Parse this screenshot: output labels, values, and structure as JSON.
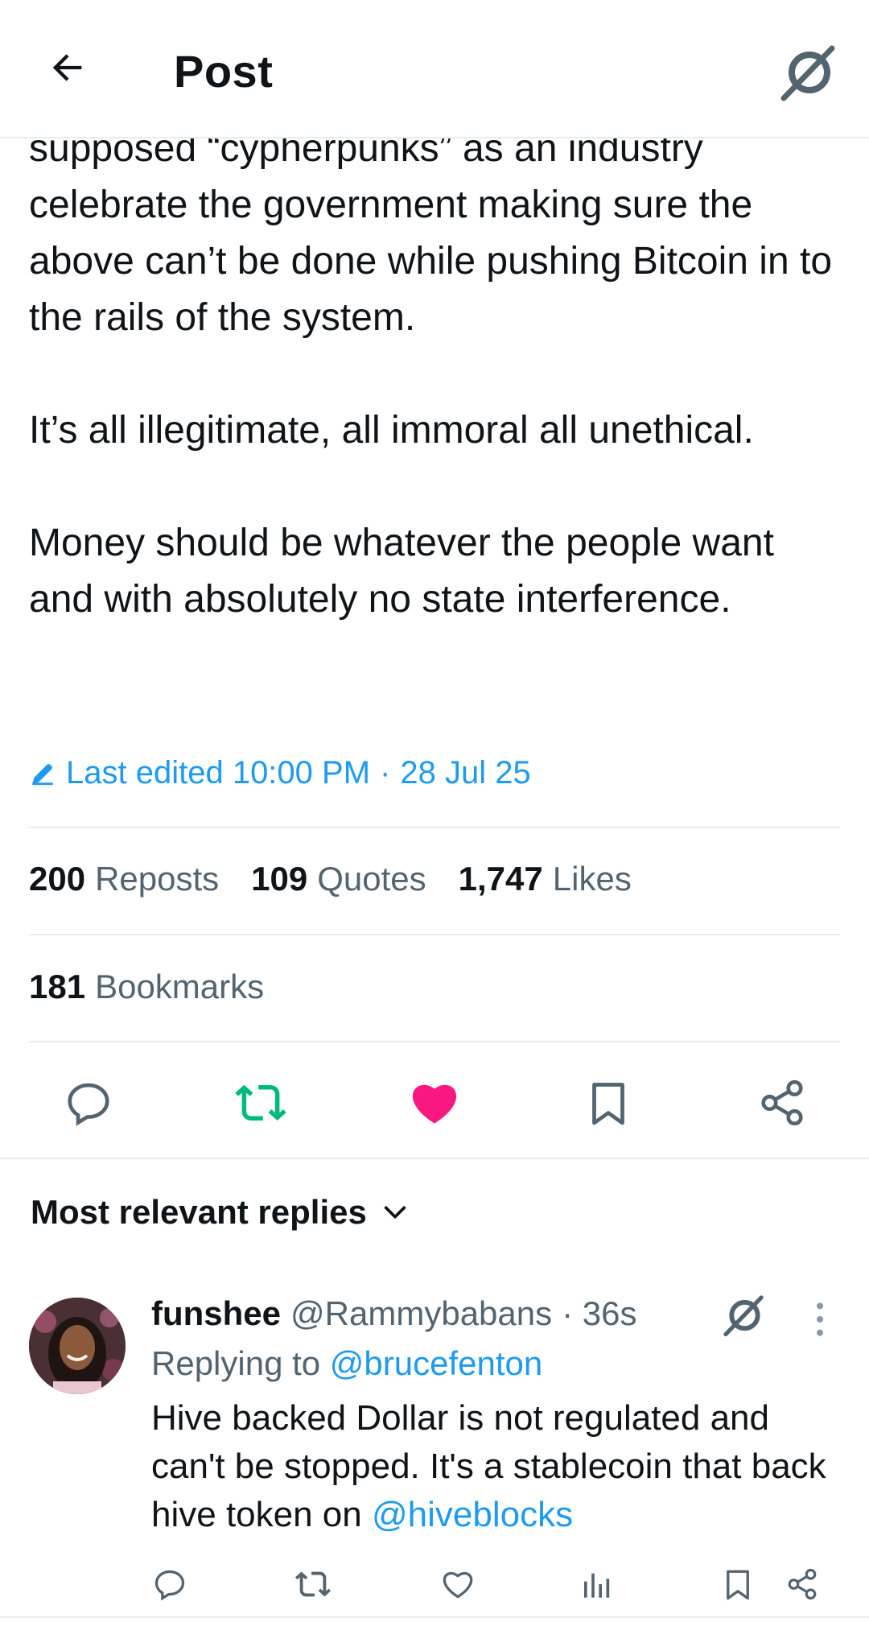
{
  "header": {
    "title": "Post"
  },
  "post": {
    "paragraphs": [
      "supposed “cypherpunks” as an industry celebrate the government making sure the above can’t be done while pushing Bitcoin in to the rails of the system.",
      "It’s all illegitimate, all immoral all unethical.",
      "Money should be whatever the people want and with absolutely no state interference."
    ],
    "edited_label": "Last edited 10:00 PM",
    "edited_date": "28 Jul 25",
    "stats": {
      "reposts_count": "200",
      "reposts_label": "Reposts",
      "quotes_count": "109",
      "quotes_label": "Quotes",
      "likes_count": "1,747",
      "likes_label": "Likes",
      "bookmarks_count": "181",
      "bookmarks_label": "Bookmarks"
    },
    "actions": [
      "reply-icon",
      "repost-icon",
      "like-icon",
      "bookmark-icon",
      "share-icon"
    ],
    "colors": {
      "repost_active": "#00ba7c",
      "like_active": "#f91880",
      "link": "#1d9bf0"
    }
  },
  "replies": {
    "sort_label": "Most relevant replies",
    "items": [
      {
        "name": "funshee",
        "handle": "@Rammybabans",
        "time": "· 36s",
        "replying_prefix": "Replying to",
        "replying_to": "@brucefenton",
        "text": "Hive backed Dollar is not regulated and can't be stopped. It's a stablecoin that back hive token on",
        "mention": "@hiveblocks"
      }
    ]
  }
}
